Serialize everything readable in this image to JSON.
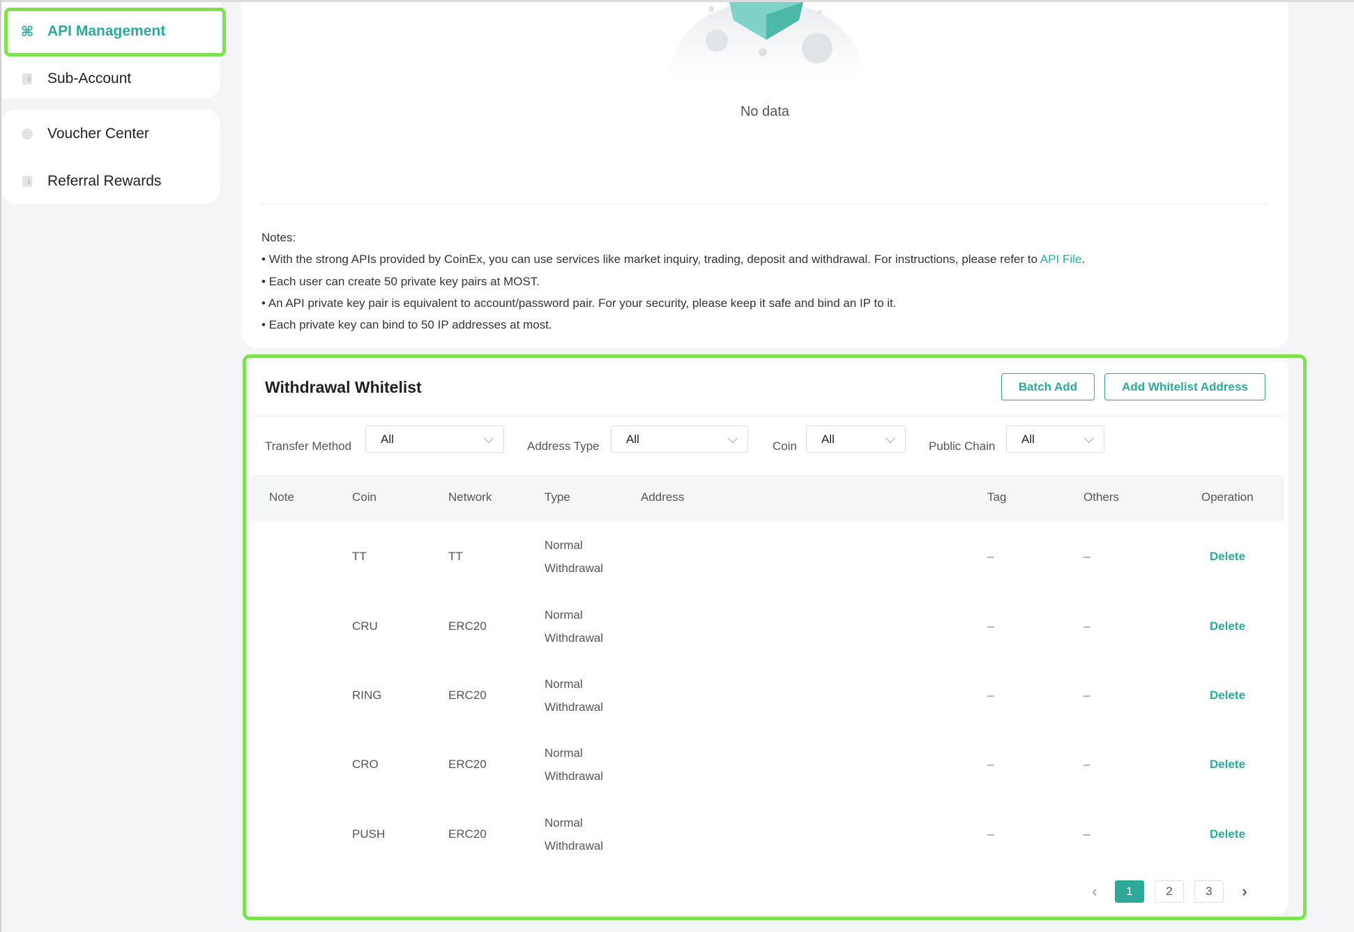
{
  "sidebar": {
    "group1": [
      {
        "label": "API Management",
        "icon": "api-icon",
        "active": true
      },
      {
        "label": "Sub-Account",
        "icon": "sub-account-icon"
      }
    ],
    "group2": [
      {
        "label": "Voucher Center",
        "icon": "voucher-icon"
      },
      {
        "label": "Referral Rewards",
        "icon": "referral-icon"
      }
    ]
  },
  "api": {
    "empty_text": "No data",
    "notes_title": "Notes:",
    "note1_text": "With the strong APIs provided by CoinEx, you can use services like market inquiry, trading, deposit and withdrawal. For instructions, please refer to ",
    "note1_link": "API File",
    "note1_end": ".",
    "note2": "Each user can create 50 private key pairs at MOST.",
    "note3": "An API private key pair is equivalent to account/password pair. For your security, please keep it safe and bind an IP to it.",
    "note4": "Each private key can bind to 50 IP addresses at most."
  },
  "whitelist": {
    "title": "Withdrawal Whitelist",
    "batch_add": "Batch Add",
    "add_address": "Add Whitelist Address",
    "filters": [
      {
        "label": "Transfer Method",
        "value": "All"
      },
      {
        "label": "Address Type",
        "value": "All"
      },
      {
        "label": "Coin",
        "value": "All"
      },
      {
        "label": "Public Chain",
        "value": "All"
      }
    ],
    "columns": [
      "Note",
      "Coin",
      "Network",
      "Type",
      "Address",
      "Tag",
      "Others",
      "Operation"
    ],
    "rows": [
      {
        "note": "",
        "coin": "TT",
        "network": "TT",
        "type_line1": "Normal",
        "type_line2": "Withdrawal",
        "address": "",
        "tag": "–",
        "others": "–",
        "operation": "Delete"
      },
      {
        "note": "",
        "coin": "CRU",
        "network": "ERC20",
        "type_line1": "Normal",
        "type_line2": "Withdrawal",
        "address": "",
        "tag": "–",
        "others": "–",
        "operation": "Delete"
      },
      {
        "note": "",
        "coin": "RING",
        "network": "ERC20",
        "type_line1": "Normal",
        "type_line2": "Withdrawal",
        "address": "",
        "tag": "–",
        "others": "–",
        "operation": "Delete"
      },
      {
        "note": "",
        "coin": "CRO",
        "network": "ERC20",
        "type_line1": "Normal",
        "type_line2": "Withdrawal",
        "address": "",
        "tag": "–",
        "others": "–",
        "operation": "Delete"
      },
      {
        "note": "",
        "coin": "PUSH",
        "network": "ERC20",
        "type_line1": "Normal",
        "type_line2": "Withdrawal",
        "address": "",
        "tag": "–",
        "others": "–",
        "operation": "Delete"
      }
    ],
    "pagination": {
      "prev": "‹",
      "pages": [
        "1",
        "2",
        "3"
      ],
      "current": "1",
      "next": "›"
    }
  },
  "colors": {
    "accent": "#2ea899",
    "highlight": "#7ee24f"
  }
}
